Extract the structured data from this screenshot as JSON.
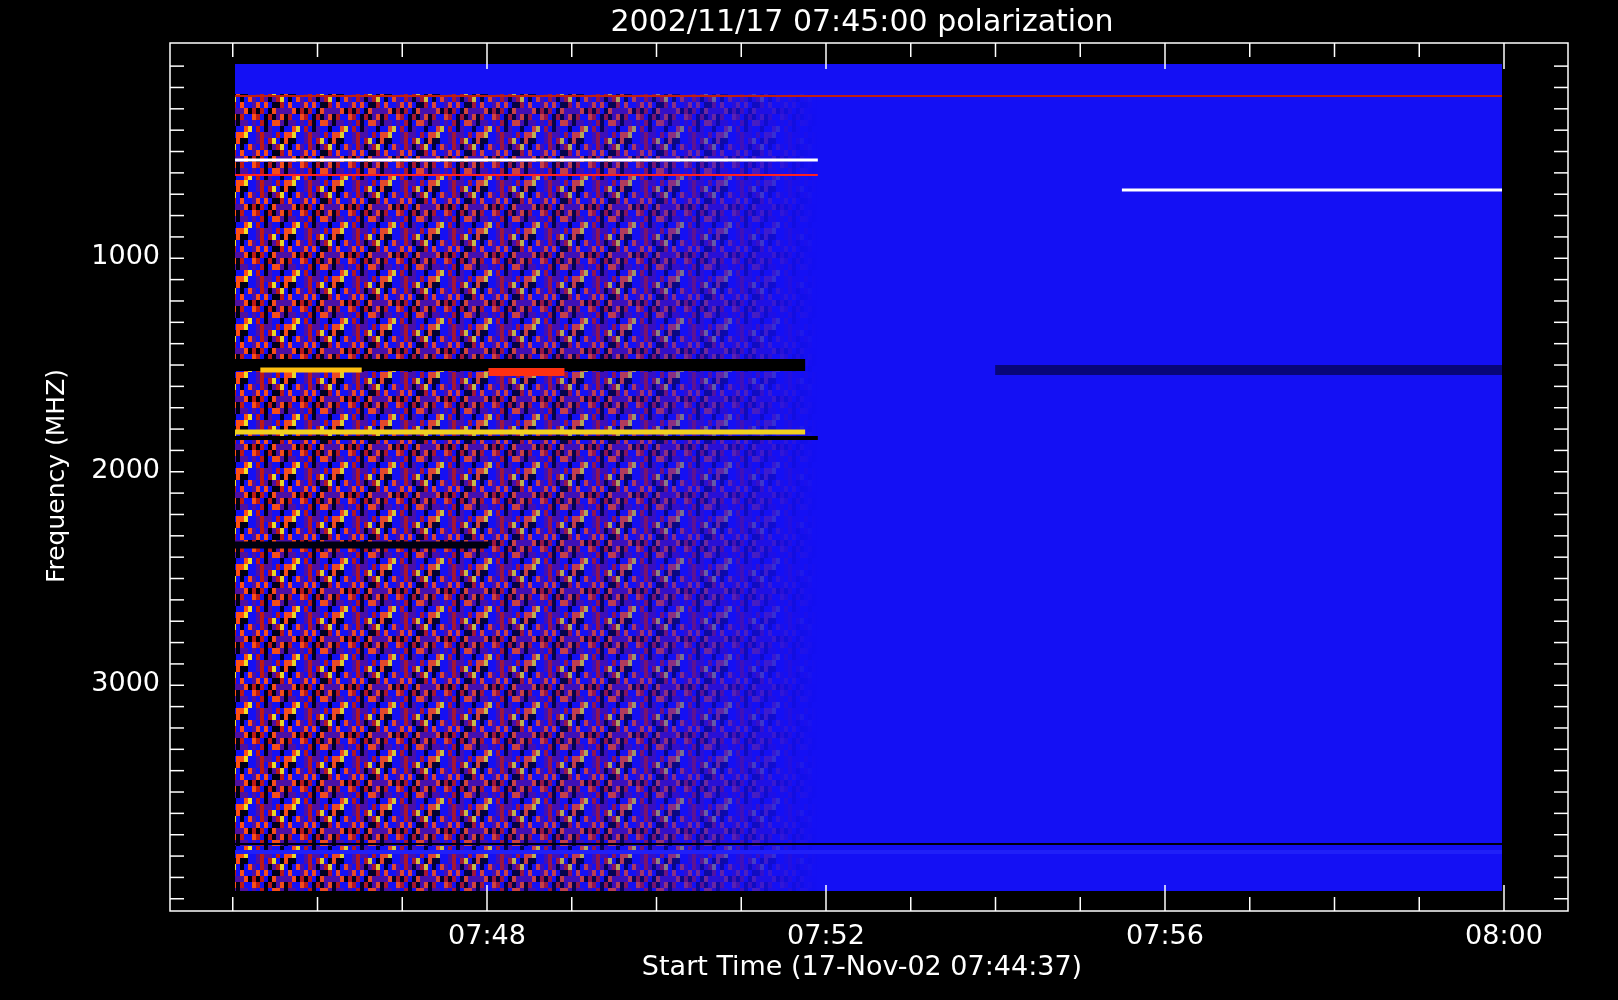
{
  "title": "2002/11/17 07:45:00 polarization",
  "y_axis": {
    "label": "Frequency (MHZ)",
    "ticks": [
      "1000",
      "2000",
      "3000"
    ]
  },
  "x_axis": {
    "label": "Start Time (17-Nov-02 07:44:37)",
    "ticks": [
      "07:48",
      "07:52",
      "07:56",
      "08:00"
    ]
  }
}
